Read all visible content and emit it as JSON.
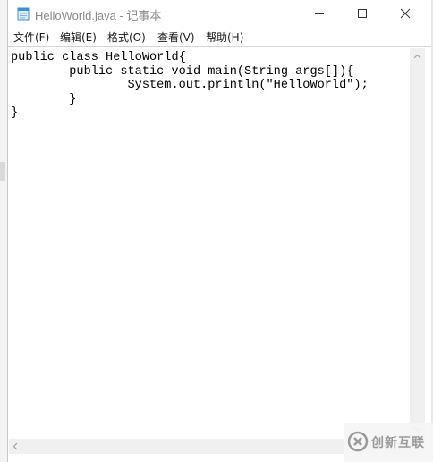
{
  "window": {
    "title": "HelloWorld.java - 记事本",
    "icon": "notepad-icon",
    "controls": [
      "minimize-icon",
      "maximize-icon",
      "close-icon"
    ]
  },
  "menu": [
    {
      "label": "文件(F)"
    },
    {
      "label": "编辑(E)"
    },
    {
      "label": "格式(O)"
    },
    {
      "label": "查看(V)"
    },
    {
      "label": "帮助(H)"
    }
  ],
  "editor": {
    "content": "public class HelloWorld{\n        public static void main(String args[]){\n                System.out.println(\"HelloWorld\");\n        }\n}"
  },
  "watermark": {
    "text": "创新互联",
    "icon": "brand-logo-icon"
  },
  "colors": {
    "title_text": "#8a8a8a",
    "scrollbar": "#f0f0f0"
  }
}
